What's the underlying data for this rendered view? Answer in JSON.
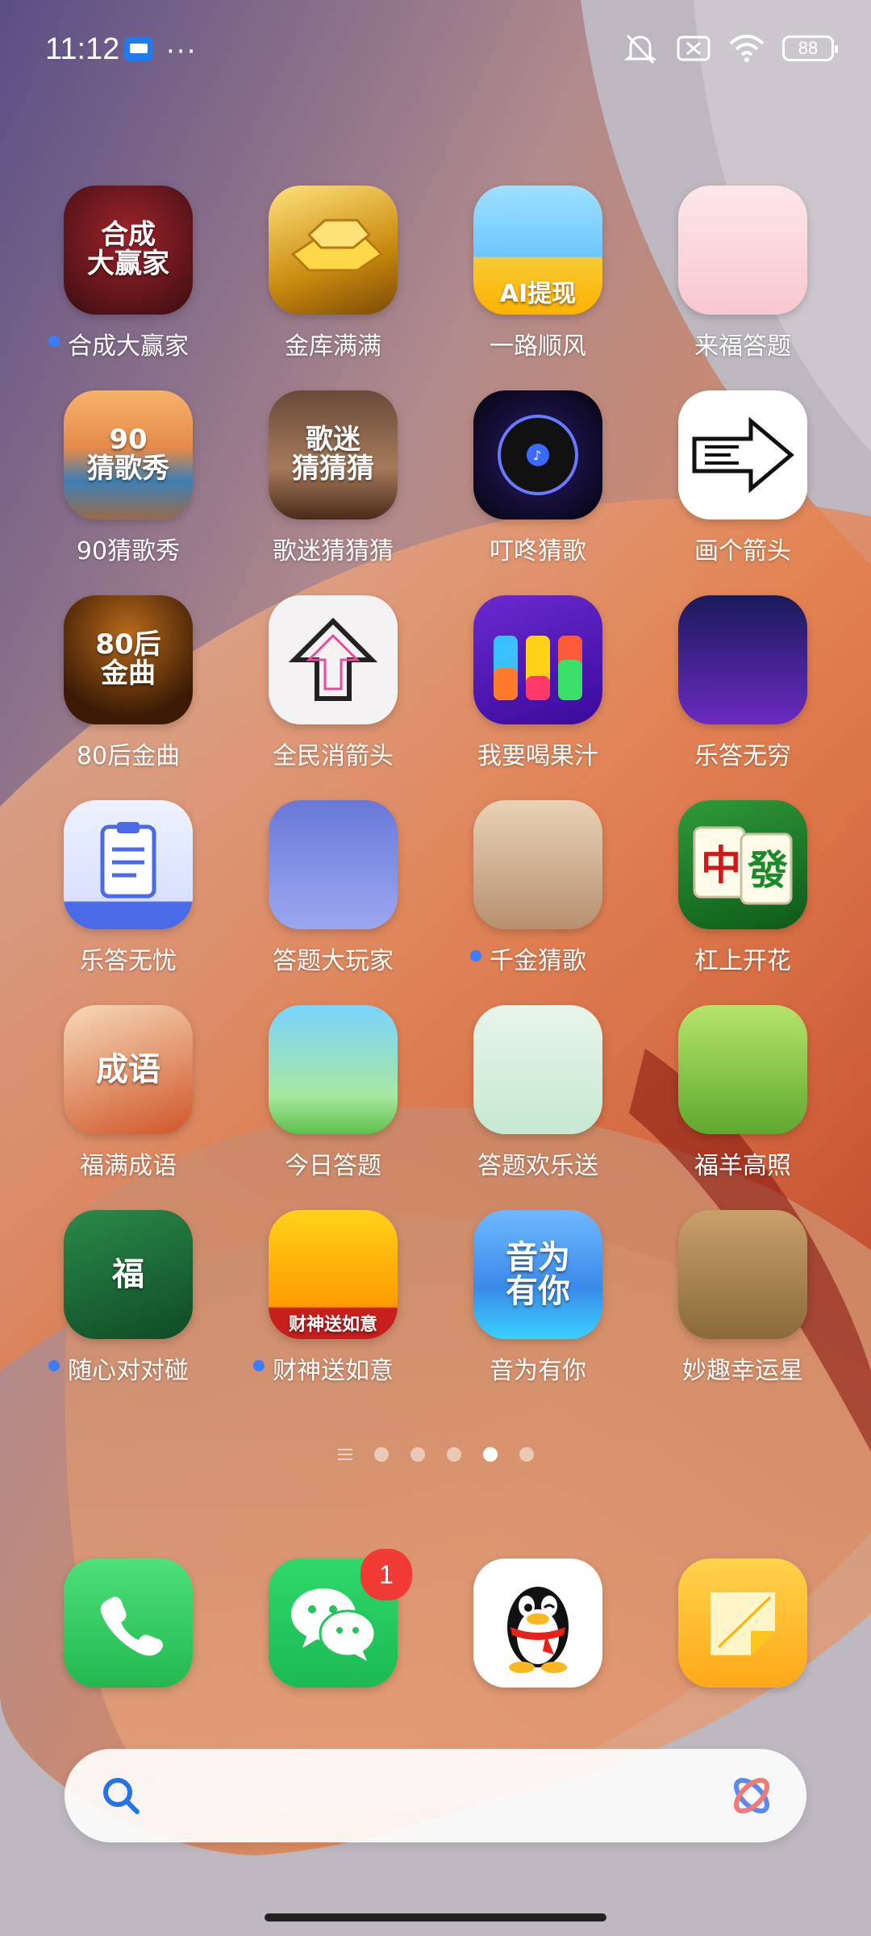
{
  "status_bar": {
    "time": "11:12",
    "battery": "88"
  },
  "apps": [
    {
      "label": "合成大赢家",
      "dot": true,
      "icon": "trophy-football-icon",
      "art": "合成\n大赢家",
      "bg": "radial-gradient(circle at 50% 40%,#a0242b,#3a0d12)"
    },
    {
      "label": "金库满满",
      "dot": false,
      "icon": "gold-bars-icon",
      "art": "",
      "bg": "linear-gradient(160deg,#ffe27a,#c98a10 60%,#7a4a05)"
    },
    {
      "label": "一路顺风",
      "dot": false,
      "icon": "animals-car-icon",
      "art": "AI提现",
      "bg": "linear-gradient(180deg,#9fe0ff,#6cc6ff 55%,#f7c934 56%,#ffb300)"
    },
    {
      "label": "来福答题",
      "dot": false,
      "icon": "girl-pencil-icon",
      "art": "",
      "bg": "linear-gradient(180deg,#fde6e9,#f7c8cf)"
    },
    {
      "label": "90猜歌秀",
      "dot": false,
      "icon": "sunset-balcony-icon",
      "art": "90\n猜歌秀",
      "bg": "linear-gradient(180deg,#f7b36a,#e48a4a 45%,#3d7fb3 70%,#9a6a4a)"
    },
    {
      "label": "歌迷猜猜猜",
      "dot": false,
      "icon": "cafe-table-icon",
      "art": "歌迷\n猜猜猜",
      "bg": "linear-gradient(180deg,#6a4a3a,#a57a5a 60%,#4a2a1a)"
    },
    {
      "label": "叮咚猜歌",
      "dot": false,
      "icon": "vinyl-record-icon",
      "art": "",
      "bg": "radial-gradient(circle,#2a1a6a,#05040f)"
    },
    {
      "label": "画个箭头",
      "dot": false,
      "icon": "maze-arrow-icon",
      "art": "",
      "bg": "#ffffff"
    },
    {
      "label": "80后金曲",
      "dot": false,
      "icon": "piano-lights-icon",
      "art": "80后\n金曲",
      "bg": "radial-gradient(circle at 50% 30%,#b86a1a,#3a1a05 75%)"
    },
    {
      "label": "全民消箭头",
      "dot": false,
      "icon": "double-arrow-icon",
      "art": "",
      "bg": "#f4f2f3"
    },
    {
      "label": "我要喝果汁",
      "dot": false,
      "icon": "juice-bottles-icon",
      "art": "",
      "bg": "linear-gradient(160deg,#6a2ad0,#3a0a9a)"
    },
    {
      "label": "乐答无穷",
      "dot": false,
      "icon": "girl-screen-icon",
      "art": "",
      "bg": "linear-gradient(180deg,#1a1a5a,#6a2ac0)"
    },
    {
      "label": "乐答无忧",
      "dot": false,
      "icon": "clipboard-icon",
      "art": "",
      "bg": "linear-gradient(180deg,#eef2ff,#d7e0ff 78%,#4a6ae8 79%)"
    },
    {
      "label": "答题大玩家",
      "dot": false,
      "icon": "woman-portrait-icon",
      "art": "",
      "bg": "linear-gradient(180deg,#6a78d8,#9aa8f0)"
    },
    {
      "label": "千金猜歌",
      "dot": true,
      "icon": "dancing-girl-icon",
      "art": "",
      "bg": "linear-gradient(180deg,#e8d2b5,#b89070)"
    },
    {
      "label": "杠上开花",
      "dot": false,
      "icon": "mahjong-tiles-icon",
      "art": "",
      "bg": "linear-gradient(160deg,#2f9a3a,#0d5a18)"
    },
    {
      "label": "福满成语",
      "dot": false,
      "icon": "brush-calligraphy-icon",
      "art": "成语",
      "bg": "linear-gradient(160deg,#f6d9b8,#d0562a)"
    },
    {
      "label": "今日答题",
      "dot": false,
      "icon": "boy-book-icon",
      "art": "",
      "bg": "linear-gradient(180deg,#7ad3ff,#a8e7a0 70%,#5fbf4a)"
    },
    {
      "label": "答题欢乐送",
      "dot": false,
      "icon": "girl-reading-icon",
      "art": "",
      "bg": "linear-gradient(180deg,#e7f5ea,#c7e8d2)"
    },
    {
      "label": "福羊高照",
      "dot": false,
      "icon": "sheep-field-icon",
      "art": "",
      "bg": "linear-gradient(180deg,#b6e46a,#5fa830)"
    },
    {
      "label": "随心对对碰",
      "dot": true,
      "icon": "fortune-tiles-icon",
      "art": "福",
      "bg": "linear-gradient(160deg,#2a8a4a,#0f4a25)"
    },
    {
      "label": "财神送如意",
      "dot": true,
      "icon": "ruyi-scepter-icon",
      "art": "财神送如意",
      "bg": "linear-gradient(180deg,#ffd21a,#ff9a00 75%,#c71e1e 76%)"
    },
    {
      "label": "音为有你",
      "dot": false,
      "icon": "amusement-park-icon",
      "art": "音为\n有你",
      "bg": "linear-gradient(180deg,#6fb8ff,#3a8ae8 60%,#3ad0ff)"
    },
    {
      "label": "妙趣幸运星",
      "dot": false,
      "icon": "cute-sheep-icon",
      "art": "",
      "bg": "linear-gradient(180deg,#c8a06a,#8a6a3a)"
    }
  ],
  "pager": {
    "pages": 5,
    "active": 3
  },
  "dock": [
    {
      "name": "phone",
      "icon": "phone-icon",
      "bg": "linear-gradient(180deg,#4ee07a,#22b84f)"
    },
    {
      "name": "wechat",
      "icon": "wechat-icon",
      "bg": "linear-gradient(180deg,#2fd86a,#1cb953)",
      "badge": "1"
    },
    {
      "name": "qq",
      "icon": "qq-penguin-icon",
      "bg": "#ffffff"
    },
    {
      "name": "notes",
      "icon": "notes-icon",
      "bg": "linear-gradient(180deg,#ffd34a,#ffa81a)"
    }
  ]
}
